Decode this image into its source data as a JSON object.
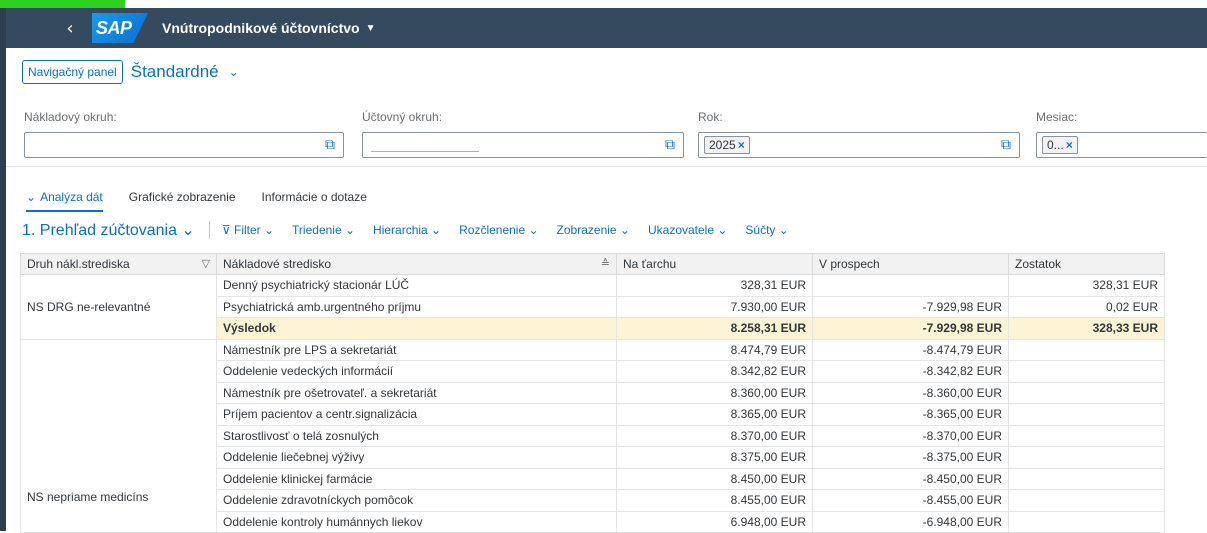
{
  "shell": {
    "back_icon": "‹",
    "logo_text": "SAP",
    "app_title": "Vnútropodnikové účtovníctvo",
    "app_title_caret": "▼"
  },
  "variant_bar": {
    "nav_button": "Navigačný panel",
    "variant_name": "Štandardné",
    "variant_chevron": "⌄"
  },
  "filters": [
    {
      "label": "Nákladový okruh:",
      "token": ""
    },
    {
      "label": "Účtovný okruh:",
      "token": ""
    },
    {
      "label": "Rok:",
      "token": "2025"
    },
    {
      "label": "Mesiac:",
      "token": "0..."
    }
  ],
  "tabs": [
    {
      "label": "Analýza dát",
      "active": true
    },
    {
      "label": "Grafické zobrazenie",
      "active": false
    },
    {
      "label": "Informácie o dotaze",
      "active": false
    }
  ],
  "toolbar": {
    "report_title": "1. Prehľad zúčtovania",
    "items": [
      "Filter",
      "Triedenie",
      "Hierarchia",
      "Rozčlenenie",
      "Zobrazenie",
      "Ukazovatele",
      "Súčty"
    ]
  },
  "table": {
    "headers": [
      "Druh nákl.strediska",
      "Nákladové stredisko",
      "Na ťarchu",
      "V prospech",
      "Zostatok"
    ],
    "group1": {
      "label": "NS DRG ne-relevantné",
      "rows": [
        [
          "Denný psychiatrický stacionár LÚČ",
          "328,31 EUR",
          "",
          "328,31 EUR"
        ],
        [
          "Psychiatrická amb.urgentného príjmu",
          "7.930,00 EUR",
          "-7.929,98 EUR",
          "0,02 EUR"
        ]
      ],
      "total": [
        "Výsledok",
        "8.258,31 EUR",
        "-7.929,98 EUR",
        "328,33 EUR"
      ]
    },
    "group2": {
      "label": "NS nepriame medicíns",
      "rows": [
        [
          "Námestník pre LPS a sekretariát",
          "8.474,79 EUR",
          "-8.474,79 EUR",
          ""
        ],
        [
          "Oddelenie vedeckých informácií",
          "8.342,82 EUR",
          "-8.342,82 EUR",
          ""
        ],
        [
          "Námestník pre ošetrovateľ. a sekretariát",
          "8.360,00 EUR",
          "-8.360,00 EUR",
          ""
        ],
        [
          "Príjem pacientov a centr.signalizácia",
          "8.365,00 EUR",
          "-8.365,00 EUR",
          ""
        ],
        [
          "Starostlivosť o telá zosnulých",
          "8.370,00 EUR",
          "-8.370,00 EUR",
          ""
        ],
        [
          "Oddelenie liečebnej výživy",
          "8.375,00 EUR",
          "-8.375,00 EUR",
          ""
        ],
        [
          "Oddelenie klinickej farmácie",
          "8.450,00 EUR",
          "-8.450,00 EUR",
          ""
        ],
        [
          "Oddelenie zdravotníckych pomôcok",
          "8.455,00 EUR",
          "-8.455,00 EUR",
          ""
        ],
        [
          "Oddelenie kontroly humánnych liekov",
          "6.948,00 EUR",
          "-6.948,00 EUR",
          ""
        ]
      ]
    }
  }
}
